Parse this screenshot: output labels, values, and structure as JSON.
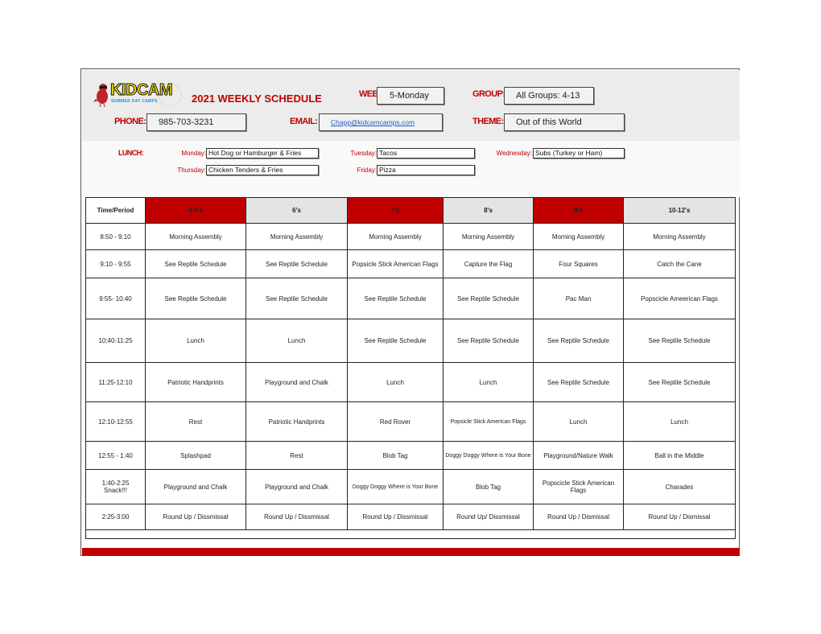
{
  "header": {
    "logo_text": "KIDCAM",
    "logo_subtext": "SUMMER DAY CAMPS",
    "title": "2021 WEEKLY SCHEDULE",
    "week_label": "WEEK:",
    "week_value": "5-Monday",
    "group_label": "GROUP:",
    "group_value": "All Groups: 4-13",
    "phone_label": "PHONE:",
    "phone_value": "985-703-3231",
    "email_label": "EMAIL:",
    "email_value": "Chapp@kidcamcamps.com",
    "theme_label": "THEME:",
    "theme_value": "Out of this World"
  },
  "lunch": {
    "label": "LUNCH:",
    "days": [
      {
        "day": "Monday:",
        "menu": "Hot Dog or Hamburger  & Fries"
      },
      {
        "day": "Tuesday:",
        "menu": "Tacos"
      },
      {
        "day": "Wednesday:",
        "menu": "Subs (Turkey or Ham)"
      },
      {
        "day": "Thursday:",
        "menu": "Chicken Tenders & Fries"
      },
      {
        "day": "Friday:",
        "menu": "Pizza"
      }
    ]
  },
  "schedule": {
    "columns": [
      "Time/Period",
      "4-5's",
      "6's",
      "7's",
      "8's",
      "9's",
      "10-12's"
    ],
    "rows": [
      {
        "time": "8:50 - 9:10",
        "cells": [
          "Morning Assembly",
          "Morning Assembly",
          "Morning Assembly",
          "Morning Assembly",
          "Morning Assembly",
          "Morning Assembly"
        ]
      },
      {
        "time": "9:10 - 9:55",
        "cells": [
          "See Reptile Schedule",
          "See Reptile Schedule",
          "Popsicle Stick American Flags",
          "Capture the Flag",
          "Four Squares",
          "Catch the Cane"
        ]
      },
      {
        "time": "9:55- 10:40",
        "cells": [
          "See Reptile Schedule",
          "See Reptile Schedule",
          "See Reptile Schedule",
          "See Reptile Schedule",
          "Pac Man",
          "Popscicle Ameerican Flags"
        ]
      },
      {
        "time": "10:40-11:25",
        "cells": [
          "Lunch",
          "Lunch",
          "See Reptile Schedule",
          "See Reptile Schedule",
          "See Reptile Schedule",
          "See Reptile Schedule"
        ]
      },
      {
        "time": "11:25-12:10",
        "cells": [
          "Patriotic Handprints",
          "Playground and Chalk",
          "Lunch",
          "Lunch",
          "See Reptile Schedule",
          "See Reptile Schedule"
        ]
      },
      {
        "time": "12:10-12:55",
        "cells": [
          "Rest",
          "Patriotic Handprints",
          "Red Rover",
          "Popsicle Stick American Flags",
          "Lunch",
          "Lunch"
        ]
      },
      {
        "time": "12:55 - 1:40",
        "cells": [
          "Splashpad",
          "Rest",
          "Blob Tag",
          "Doggy Doggy Where is Your Bone",
          "Playground/Nature Walk",
          "Ball in the Middle"
        ]
      },
      {
        "time": "1:40-2:25 Snack!!!",
        "cells": [
          "Playground and Chalk",
          "Playground and Chalk",
          "Doggy Doggy Where is Your Bone",
          "Blob Tag",
          "Popscicle Stick American Flags",
          "Charades"
        ]
      },
      {
        "time": "2:25-3:00",
        "cells": [
          "Round Up / Dissmissal",
          "Round Up / Dissmissal",
          "Round Up / Dissmissal",
          "Round Up/ Dissmissal",
          "Round Up / Dismissal",
          "Round Up / Dismissal"
        ]
      }
    ]
  },
  "colors": {
    "accent_red": "#c00000",
    "header_grey": "#e4e4e4",
    "link_blue": "#1f5fbf"
  }
}
